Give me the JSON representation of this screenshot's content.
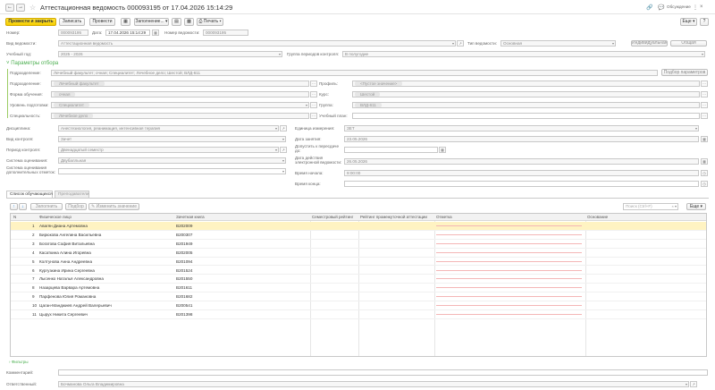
{
  "window": {
    "title": "Аттестационная ведомость 000093195 от 17.04.2026 15:14:29",
    "discussions": "Обсуждение"
  },
  "toolbar": {
    "post_close": "Провести и закрыть",
    "save": "Записать",
    "post": "Провести",
    "fill": "Заполнение...",
    "print": "Печать",
    "more": "Еще"
  },
  "header": {
    "number_label": "Номер:",
    "number_value": "000093195",
    "date_label": "Дата:",
    "date_value": "17.04.2026 15:14:29",
    "sheet_number_label": "Номер ведомости:",
    "sheet_number_value": "000093195",
    "sheet_type_label": "Вид ведомости:",
    "sheet_type_value": "Аттестационная ведомость",
    "sheet_kind_label": "Тип ведомости:",
    "sheet_kind_value": "Основная",
    "individual_btn": "Индивидуальная",
    "common_btn": "Общая",
    "year_label": "Учебный год:",
    "year_value": "2025 - 2026",
    "period_group_label": "Группа периодов контроля:",
    "period_group_value": "В полугодие"
  },
  "filters": {
    "section_title": "Параметры отбора",
    "division_label": "Подразделение:",
    "division_value": "Лечебный факультет; очная; Специалитет; Лечебное дело; Шестой; ВЛД-611",
    "select_params_btn": "Подбор параметров",
    "subdivision_label": "Подразделение:",
    "subdivision_value": "Лечебный факультет",
    "profile_label": "Профиль:",
    "profile_value": "<Пустое значение>",
    "study_form_label": "Форма обучения:",
    "study_form_value": "очная",
    "course_label": "Курс:",
    "course_value": "Шестой",
    "level_label": "Уровень подготовки:",
    "level_value": "Специалитет",
    "group_label": "Группа:",
    "group_value": "ВЛД-611",
    "specialty_label": "Специальность:",
    "specialty_value": "Лечебное дело",
    "plan_label": "Учебный план:",
    "plan_value": ""
  },
  "details": {
    "discipline_label": "Дисциплина:",
    "discipline_value": "Анестезиология, реанимация, интенсивная терапия",
    "unit_label": "Единица измерения:",
    "unit_value": "ЗЕТ",
    "control_type_label": "Вид контроля:",
    "control_type_value": "Зачет",
    "lesson_date_label": "Дата занятия:",
    "lesson_date_value": "23.05.2026",
    "control_period_label": "Период контроля:",
    "control_period_value": "Двенадцатый семестр",
    "admit_label": "Допустить к пересдаче до:",
    "admit_value": "",
    "grading_label": "Система оценивания:",
    "grading_value": "Двубалльная",
    "valid_until_label": "Дата действия электронной ведомости:",
    "valid_until_value": "26.05.2026",
    "grading_extra_label": "Система оценивания дополнительных отметок:",
    "grading_extra_value": "",
    "start_time_label": "Время начала:",
    "start_time_value": "9:00:00",
    "end_time_label": "Время конца:",
    "end_time_value": ""
  },
  "tabs": {
    "students": "Список обучающихся",
    "teachers": "Преподаватели"
  },
  "grid_toolbar": {
    "fill": "Заполнить",
    "select": "Подбор",
    "change_value": "Изменить значение",
    "search_placeholder": "Поиск (Ctrl+F)",
    "more": "Еще"
  },
  "table": {
    "columns": [
      "N",
      "Физическое лицо",
      "Зачетная книга",
      "Семестровый рейтинг",
      "Рейтинг промежуточной аттестации",
      "Отметка",
      "Основание"
    ],
    "rows": [
      {
        "n": "1",
        "name": "Авагян Диана Артемовна",
        "book": "B202009"
      },
      {
        "n": "2",
        "name": "Бирюкова Ангелина Васильевна",
        "book": "B200307"
      },
      {
        "n": "3",
        "name": "Богатова София Витальевна",
        "book": "B201949"
      },
      {
        "n": "4",
        "name": "Касаткина Алина Игоревна",
        "book": "B202005"
      },
      {
        "n": "5",
        "name": "Колтунова Анна Андреевна",
        "book": "B201094"
      },
      {
        "n": "6",
        "name": "Кургузкина Ирина Сергеевна",
        "book": "B201524"
      },
      {
        "n": "7",
        "name": "Лысенко Наталья Александровна",
        "book": "B201550"
      },
      {
        "n": "8",
        "name": "Назарцева Варвара Артемовна",
        "book": "B201611"
      },
      {
        "n": "9",
        "name": "Парфенова Юлия Романовна",
        "book": "B201682"
      },
      {
        "n": "10",
        "name": "Цаган-Манджиев Андрей Валерьевич",
        "book": "B200541"
      },
      {
        "n": "11",
        "name": "Цырух Никита Сергеевич",
        "book": "B201398"
      }
    ]
  },
  "footer": {
    "filters_link": "Фильтры",
    "comment_label": "Комментарий:",
    "comment_value": "",
    "responsible_label": "Ответственный:",
    "responsible_value": "Бочманова Ольга Владимировна"
  }
}
